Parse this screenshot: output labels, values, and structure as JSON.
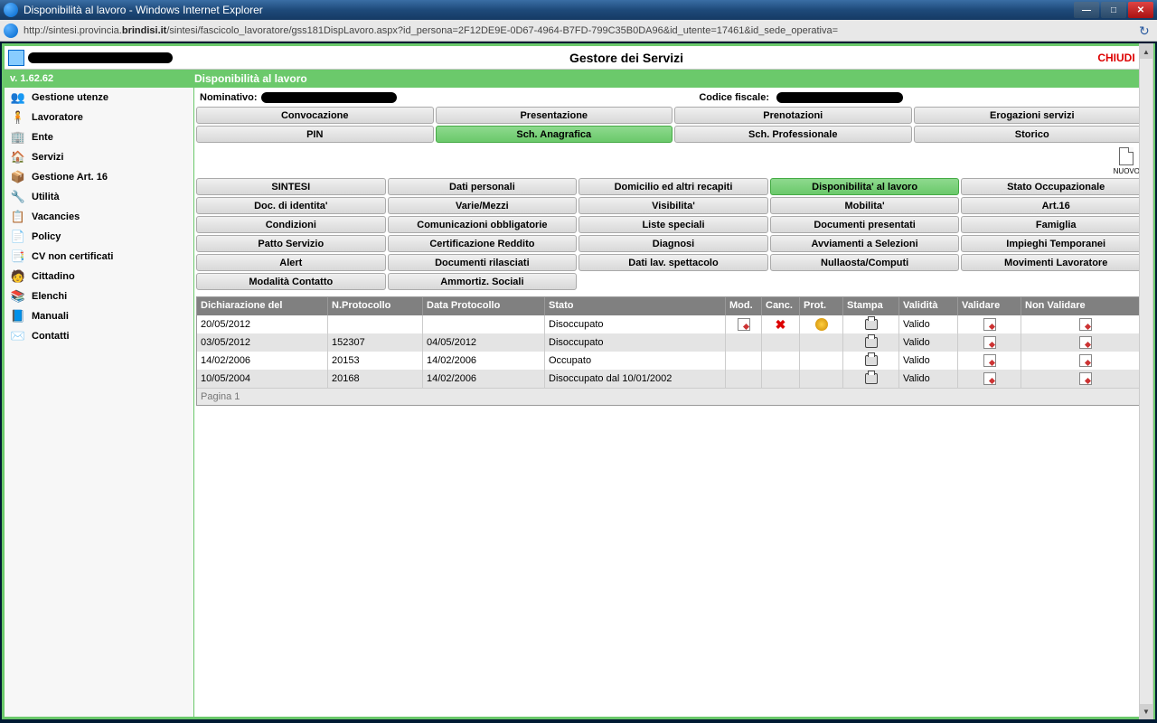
{
  "window": {
    "title": "Disponibilità al lavoro - Windows Internet Explorer",
    "url_prefix": "http://sintesi.provincia.",
    "url_host": "brindisi.it",
    "url_path": "/sintesi/fascicolo_lavoratore/gss181DispLavoro.aspx?id_persona=2F12DE9E-0D67-4964-B7FD-799C35B0DA96&id_utente=17461&id_sede_operativa="
  },
  "header": {
    "app_title": "Gestore dei Servizi",
    "close": "CHIUDI",
    "version": "v. 1.62.62",
    "page_title": "Disponibilità al lavoro"
  },
  "person": {
    "nominativo_label": "Nominativo:",
    "cf_label": "Codice fiscale:"
  },
  "sidebar": [
    {
      "label": "Gestione utenze",
      "bold": true,
      "icon": "👥"
    },
    {
      "label": "Lavoratore",
      "bold": true,
      "icon": "🧍"
    },
    {
      "label": "Ente",
      "bold": true,
      "icon": "🏢"
    },
    {
      "label": "Servizi",
      "bold": true,
      "icon": "🏠"
    },
    {
      "label": "Gestione Art. 16",
      "bold": true,
      "icon": "📦"
    },
    {
      "label": "Utilità",
      "bold": true,
      "icon": "🔧"
    },
    {
      "label": "Vacancies",
      "bold": true,
      "icon": "📋"
    },
    {
      "label": "Policy",
      "bold": true,
      "icon": "📄"
    },
    {
      "label": "CV non certificati",
      "bold": true,
      "icon": "📑"
    },
    {
      "label": "Cittadino",
      "bold": true,
      "icon": "🧑"
    },
    {
      "label": "Elenchi",
      "bold": true,
      "icon": "📚"
    },
    {
      "label": "Manuali",
      "bold": true,
      "icon": "📘"
    },
    {
      "label": "Contatti",
      "bold": true,
      "icon": "✉️"
    }
  ],
  "topbtns_row1": [
    {
      "label": "Convocazione"
    },
    {
      "label": "Presentazione"
    },
    {
      "label": "Prenotazioni"
    },
    {
      "label": "Erogazioni servizi"
    }
  ],
  "topbtns_row2": [
    {
      "label": "PIN"
    },
    {
      "label": "Sch. Anagrafica",
      "active": true
    },
    {
      "label": "Sch. Professionale"
    },
    {
      "label": "Storico"
    }
  ],
  "nuovo": "NUOVO",
  "tabs": [
    {
      "label": "SINTESI"
    },
    {
      "label": "Dati personali"
    },
    {
      "label": "Domicilio ed altri recapiti"
    },
    {
      "label": "Disponibilita' al lavoro",
      "active": true
    },
    {
      "label": "Stato Occupazionale"
    },
    {
      "label": "Doc. di identita'"
    },
    {
      "label": "Varie/Mezzi"
    },
    {
      "label": "Visibilita'"
    },
    {
      "label": "Mobilita'"
    },
    {
      "label": "Art.16"
    },
    {
      "label": "Condizioni"
    },
    {
      "label": "Comunicazioni obbligatorie"
    },
    {
      "label": "Liste speciali"
    },
    {
      "label": "Documenti presentati"
    },
    {
      "label": "Famiglia"
    },
    {
      "label": "Patto Servizio"
    },
    {
      "label": "Certificazione Reddito"
    },
    {
      "label": "Diagnosi"
    },
    {
      "label": "Avviamenti a Selezioni"
    },
    {
      "label": "Impieghi Temporanei"
    },
    {
      "label": "Alert"
    },
    {
      "label": "Documenti rilasciati"
    },
    {
      "label": "Dati lav. spettacolo"
    },
    {
      "label": "Nullaosta/Computi"
    },
    {
      "label": "Movimenti Lavoratore"
    },
    {
      "label": "Modalità Contatto"
    },
    {
      "label": "Ammortiz. Sociali"
    }
  ],
  "table": {
    "headers": {
      "dich": "Dichiarazione del",
      "prot": "N.Protocollo",
      "dprot": "Data Protocollo",
      "stato": "Stato",
      "mod": "Mod.",
      "canc": "Canc.",
      "pr": "Prot.",
      "stampa": "Stampa",
      "valid": "Validità",
      "validare": "Validare",
      "nonval": "Non Validare"
    },
    "rows": [
      {
        "dich": "20/05/2012",
        "prot": "",
        "dprot": "",
        "stato": "Disoccupato",
        "mod": true,
        "canc": true,
        "pr": true,
        "stampa": true,
        "valid": "Valido",
        "validare": true,
        "nonval": true
      },
      {
        "dich": "03/05/2012",
        "prot": "152307",
        "dprot": "04/05/2012",
        "stato": "Disoccupato",
        "mod": false,
        "canc": false,
        "pr": false,
        "stampa": true,
        "valid": "Valido",
        "validare": true,
        "nonval": true
      },
      {
        "dich": "14/02/2006",
        "prot": "20153",
        "dprot": "14/02/2006",
        "stato": "Occupato",
        "mod": false,
        "canc": false,
        "pr": false,
        "stampa": true,
        "valid": "Valido",
        "validare": true,
        "nonval": true
      },
      {
        "dich": "10/05/2004",
        "prot": "20168",
        "dprot": "14/02/2006",
        "stato": "Disoccupato dal 10/01/2002",
        "mod": false,
        "canc": false,
        "pr": false,
        "stampa": true,
        "valid": "Valido",
        "validare": true,
        "nonval": true
      }
    ],
    "pager": "Pagina 1"
  }
}
